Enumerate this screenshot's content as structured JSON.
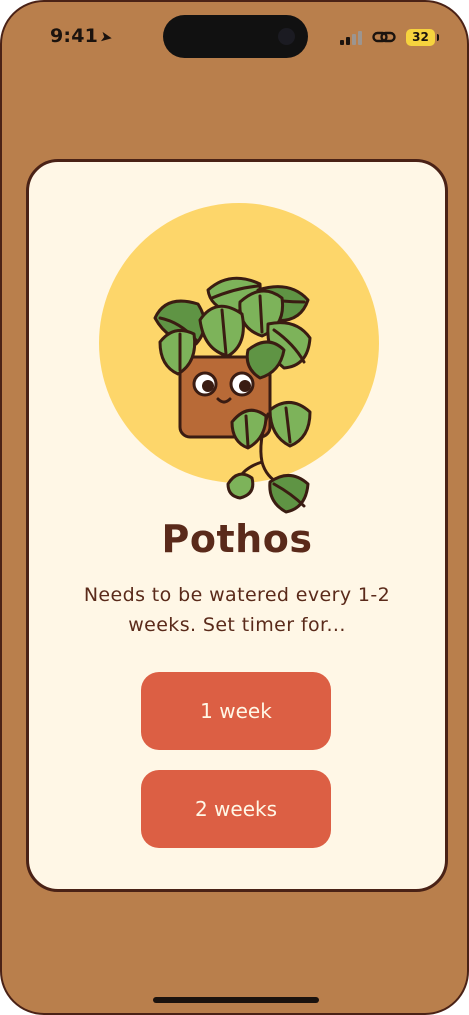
{
  "status_bar": {
    "time": "9:41",
    "location_glyph": "➤",
    "battery_level": "32"
  },
  "plant_card": {
    "name": "Pothos",
    "description": "Needs to be watered every 1-2 weeks. Set timer for...",
    "illustration": "potted-pothos-plant-with-eyes"
  },
  "actions": {
    "one_week_label": "1 week",
    "two_weeks_label": "2 weeks"
  },
  "colors": {
    "background": "#b97f4c",
    "card": "#fff7e6",
    "accent": "#dc5f44",
    "text": "#5a2a1a",
    "sun": "#fdd66a"
  }
}
